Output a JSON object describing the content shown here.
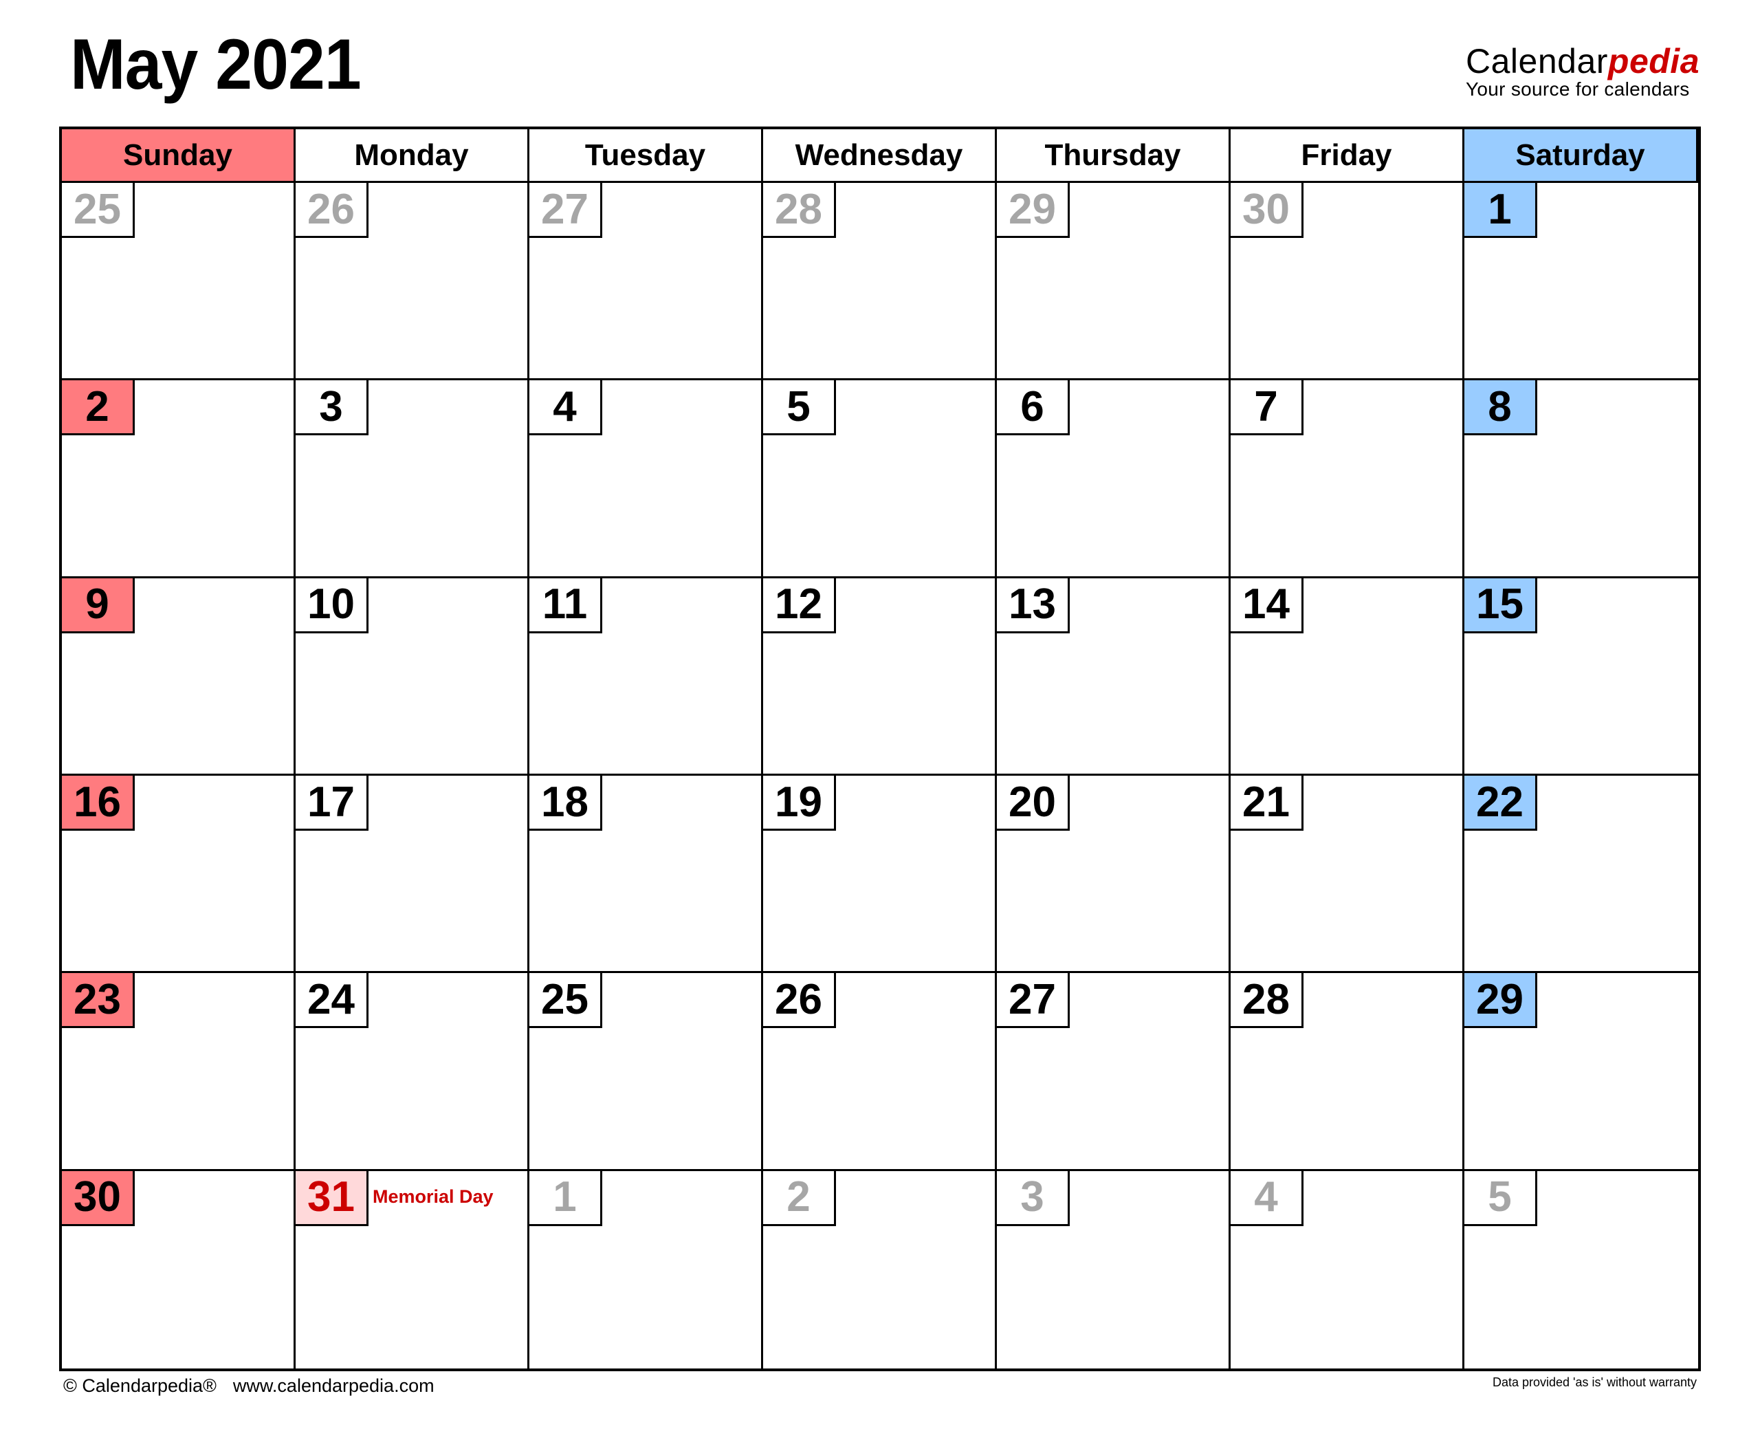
{
  "header": {
    "title": "May 2021",
    "brand": {
      "name_plain": "Calendar",
      "name_accent": "pedia",
      "tagline": "Your source for calendars"
    }
  },
  "colors": {
    "sunday_header": "#ff7b7f",
    "sunday_date": "#ff7b7f",
    "saturday_header": "#99ccff",
    "saturday_date": "#99ccff",
    "holiday_date_bg": "#ffd9da",
    "holiday_text": "#cc0000",
    "brand_accent": "#cc0000",
    "other_month_text": "#a6a6a6",
    "current_month_text": "#000000"
  },
  "weekdays": [
    "Sunday",
    "Monday",
    "Tuesday",
    "Wednesday",
    "Thursday",
    "Friday",
    "Saturday"
  ],
  "weeks": [
    [
      {
        "day": "25",
        "other_month": true
      },
      {
        "day": "26",
        "other_month": true
      },
      {
        "day": "27",
        "other_month": true
      },
      {
        "day": "28",
        "other_month": true
      },
      {
        "day": "29",
        "other_month": true
      },
      {
        "day": "30",
        "other_month": true
      },
      {
        "day": "1",
        "other_month": false
      }
    ],
    [
      {
        "day": "2",
        "other_month": false
      },
      {
        "day": "3",
        "other_month": false
      },
      {
        "day": "4",
        "other_month": false
      },
      {
        "day": "5",
        "other_month": false
      },
      {
        "day": "6",
        "other_month": false
      },
      {
        "day": "7",
        "other_month": false
      },
      {
        "day": "8",
        "other_month": false
      }
    ],
    [
      {
        "day": "9",
        "other_month": false
      },
      {
        "day": "10",
        "other_month": false
      },
      {
        "day": "11",
        "other_month": false
      },
      {
        "day": "12",
        "other_month": false
      },
      {
        "day": "13",
        "other_month": false
      },
      {
        "day": "14",
        "other_month": false
      },
      {
        "day": "15",
        "other_month": false
      }
    ],
    [
      {
        "day": "16",
        "other_month": false
      },
      {
        "day": "17",
        "other_month": false
      },
      {
        "day": "18",
        "other_month": false
      },
      {
        "day": "19",
        "other_month": false
      },
      {
        "day": "20",
        "other_month": false
      },
      {
        "day": "21",
        "other_month": false
      },
      {
        "day": "22",
        "other_month": false
      }
    ],
    [
      {
        "day": "23",
        "other_month": false
      },
      {
        "day": "24",
        "other_month": false
      },
      {
        "day": "25",
        "other_month": false
      },
      {
        "day": "26",
        "other_month": false
      },
      {
        "day": "27",
        "other_month": false
      },
      {
        "day": "28",
        "other_month": false
      },
      {
        "day": "29",
        "other_month": false
      }
    ],
    [
      {
        "day": "30",
        "other_month": false
      },
      {
        "day": "31",
        "other_month": false,
        "holiday": "Memorial Day"
      },
      {
        "day": "1",
        "other_month": true
      },
      {
        "day": "2",
        "other_month": true
      },
      {
        "day": "3",
        "other_month": true
      },
      {
        "day": "4",
        "other_month": true
      },
      {
        "day": "5",
        "other_month": true
      }
    ]
  ],
  "footer": {
    "copyright": "© Calendarpedia®",
    "website": "www.calendarpedia.com",
    "disclaimer": "Data provided 'as is' without warranty"
  }
}
